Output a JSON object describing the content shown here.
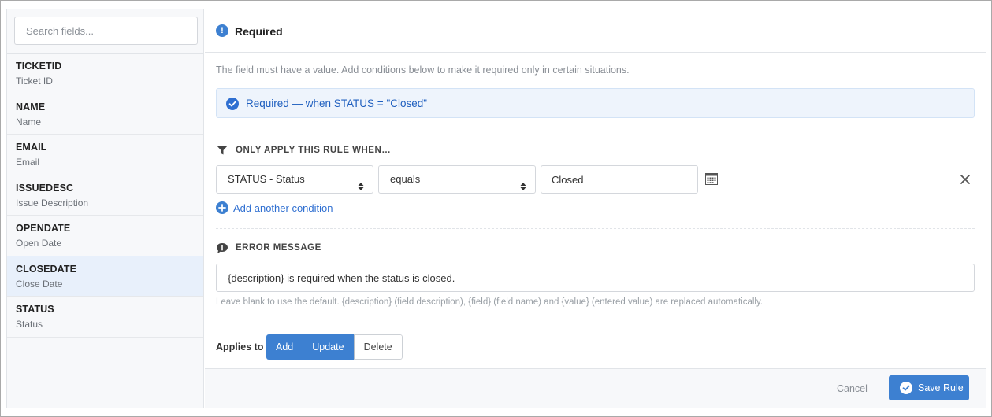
{
  "sidebar": {
    "search_placeholder": "Search fields...",
    "fields": [
      {
        "name": "TICKETID",
        "desc": "Ticket ID"
      },
      {
        "name": "NAME",
        "desc": "Name"
      },
      {
        "name": "EMAIL",
        "desc": "Email"
      },
      {
        "name": "ISSUEDESC",
        "desc": "Issue Description"
      },
      {
        "name": "OPENDATE",
        "desc": "Open Date"
      },
      {
        "name": "CLOSEDATE",
        "desc": "Close Date",
        "selected": true
      },
      {
        "name": "STATUS",
        "desc": "Status"
      }
    ]
  },
  "rule": {
    "icon": "exclamation-icon",
    "title": "Required",
    "description": "The field must have a value. Add conditions below to make it required only in certain situations.",
    "summary": "Required — when STATUS = \"Closed\""
  },
  "conditions": {
    "section_title": "ONLY APPLY THIS RULE WHEN…",
    "field_select": "STATUS - Status",
    "operator_select": "equals",
    "value": "Closed",
    "add_label": "Add another condition"
  },
  "error": {
    "section_title": "ERROR MESSAGE",
    "message": "{description} is required when the status is closed.",
    "hint": "Leave blank to use the default. {description} (field description), {field} (field name) and {value} (entered value) are replaced automatically."
  },
  "applies": {
    "label": "Applies to",
    "options": [
      {
        "label": "Add",
        "active": true
      },
      {
        "label": "Update",
        "active": true
      },
      {
        "label": "Delete",
        "active": false
      }
    ]
  },
  "footer": {
    "cancel_label": "Cancel",
    "save_label": "Save Rule"
  },
  "colors": {
    "accent": "#3d80d1",
    "selected_row": "#e8f0fb",
    "notice_bg": "#eef4fc"
  }
}
